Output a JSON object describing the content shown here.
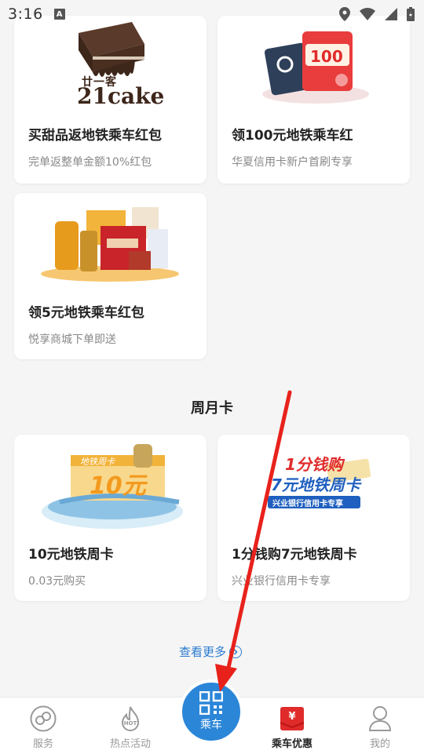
{
  "status_bar": {
    "time": "3:16"
  },
  "cards": [
    {
      "title": "买甜品返地铁乘车红包",
      "subtitle": "完单返整单金额10%红包",
      "brand_top": "廿一客",
      "brand_main": "21cake"
    },
    {
      "title": "领100元地铁乘车红",
      "subtitle": "华夏信用卡新户首刷专享",
      "amount": "100"
    },
    {
      "title": "领5元地铁乘车红包",
      "subtitle": "悦享商城下单即送"
    }
  ],
  "weekly_section": {
    "title": "周月卡",
    "cards": [
      {
        "title": "10元地铁周卡",
        "subtitle": "0.03元购买",
        "img_top": "地铁周卡",
        "img_main": "10元"
      },
      {
        "title": "1分钱购7元地铁周卡",
        "subtitle": "兴业银行信用卡专享",
        "img_line1": "1分钱购",
        "img_line2": "7元地铁周卡",
        "img_banner": "兴业银行信用卡专享"
      }
    ]
  },
  "more_link": "查看更多",
  "bottom_nav": {
    "items": [
      {
        "label": "服务",
        "icon": "service-icon"
      },
      {
        "label": "热点活动",
        "icon": "hot-icon"
      },
      {
        "label": "乘车优惠",
        "icon": "coupon-icon"
      },
      {
        "label": "我的",
        "icon": "profile-icon"
      }
    ],
    "center": {
      "label": "乘车",
      "icon": "qr-code-icon"
    }
  },
  "colors": {
    "accent": "#2b86d8",
    "coupon_red": "#e02b2b",
    "arrow": "#e8221b"
  }
}
